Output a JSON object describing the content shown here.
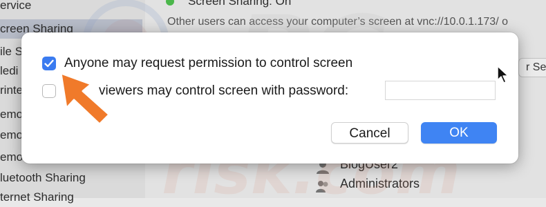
{
  "background": {
    "sidebar": {
      "items": [
        {
          "label": "ervice"
        },
        {
          "label": "creen Sharing"
        },
        {
          "label": "ile S"
        },
        {
          "label": "ledi"
        },
        {
          "label": "rinte"
        },
        {
          "label": "emo"
        },
        {
          "label": "emo"
        },
        {
          "label": "emo"
        },
        {
          "label": "luetooth Sharing"
        },
        {
          "label": "ternet Sharing"
        }
      ],
      "selected_index": 1
    },
    "status_text": "Screen Sharing: On",
    "description": "Other users can access your computer’s screen at vnc://10.0.1.173/ o",
    "settings_button_label": "r Set",
    "user_list": [
      {
        "label": "BlogUser2"
      },
      {
        "label": "Administrators"
      }
    ],
    "watermark_text": "PC risk.com"
  },
  "dialog": {
    "options": [
      {
        "label": "Anyone may request permission to control screen",
        "checked": true
      },
      {
        "label": "viewers may control screen with password:",
        "checked": false
      }
    ],
    "password_value": "",
    "cancel_label": "Cancel",
    "ok_label": "OK"
  },
  "colors": {
    "accent": "#3f84f3",
    "checkbox_checked": "#3a7bf0",
    "annotation_arrow": "#f07a2a"
  }
}
